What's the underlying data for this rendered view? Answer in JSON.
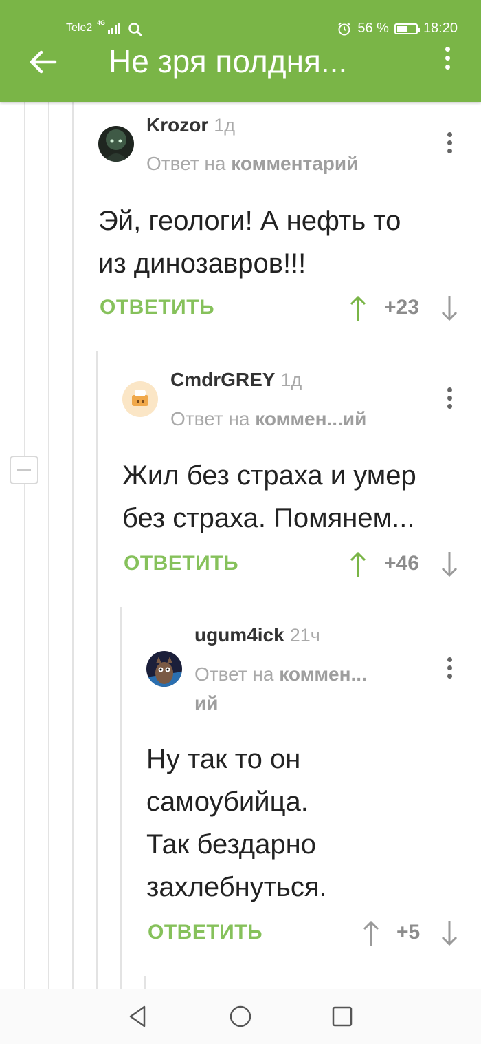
{
  "status_bar": {
    "carrier": "Tele2",
    "network": "4G",
    "battery": "56 %",
    "battery_level": 0.56,
    "time": "18:20"
  },
  "app_bar": {
    "title": "Не зря полдня..."
  },
  "comments": [
    {
      "username": "Krozor",
      "time": "1д",
      "reply_prefix": "Ответ на",
      "reply_target": "комментарий",
      "text_lines": [
        "Эй, геологи! А нефть то",
        "из динозавров!!!"
      ],
      "reply_label": "ОТВЕТИТЬ",
      "score": "+23"
    },
    {
      "username": "CmdrGREY",
      "time": "1д",
      "reply_prefix": "Ответ на",
      "reply_target": "коммен...ий",
      "text_lines": [
        "Жил без страха и умер",
        "без страха. Помянем..."
      ],
      "reply_label": "ОТВЕТИТЬ",
      "score": "+46"
    },
    {
      "username": "ugum4ick",
      "time": "21ч",
      "reply_prefix": "Ответ на",
      "reply_target": "коммен...",
      "reply_target_line2": "ий",
      "text_lines": [
        "Ну так то он",
        "самоубийца.",
        "Так бездарно",
        "захлебнуться."
      ],
      "reply_label": "ОТВЕТИТЬ",
      "score": "+5"
    }
  ],
  "colors": {
    "accent": "#7ab547",
    "reply_green": "#86c15b"
  }
}
